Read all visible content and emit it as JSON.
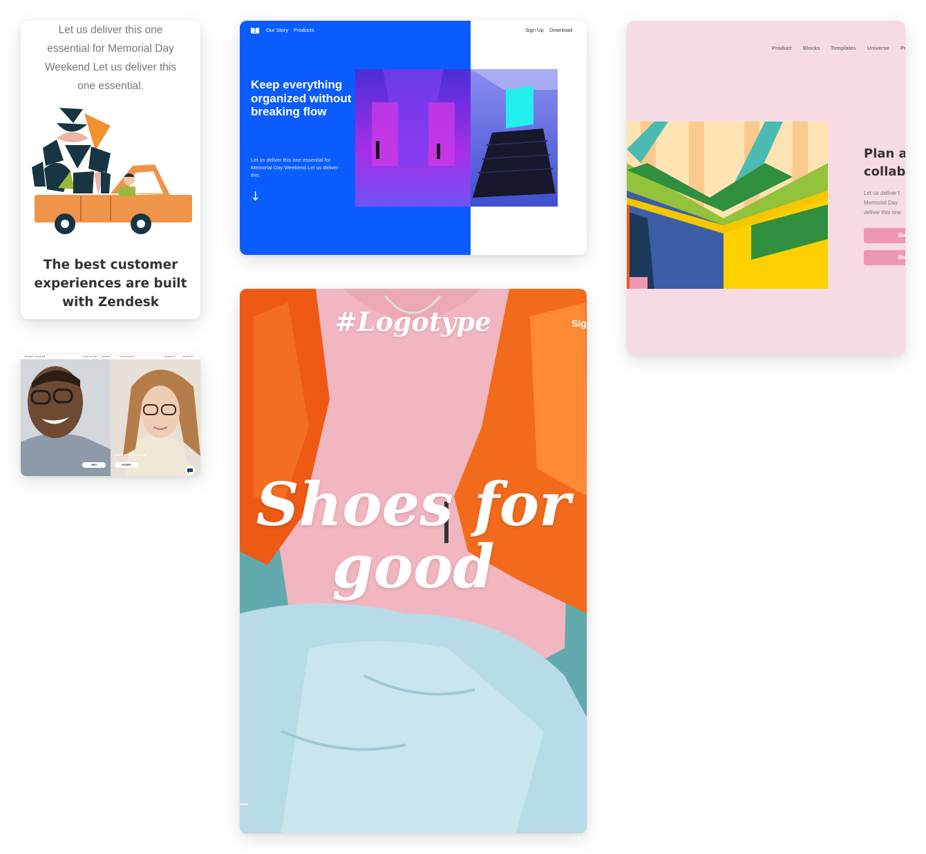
{
  "zendesk_card": {
    "intro": "Let us deliver this one essential for Memorial Day Weekend Let us deliver this one essential.",
    "headline": "The best customer experiences are built with Zendesk"
  },
  "warby_card": {
    "brand": "WARBY PARKER",
    "nav": [
      "OUR STORY",
      "EXAMS",
      "LOCATIONS"
    ],
    "search_label": "SEARCH",
    "signin_label": "SIGN IN",
    "shop_label": "SHOP ONLINE",
    "men_button": "MEN",
    "women_button": "WOMEN"
  },
  "blue_card": {
    "nav": [
      "Our Story",
      "Products"
    ],
    "right_nav": [
      "Sign Up",
      "Download"
    ],
    "headline": "Keep everything organized without breaking flow",
    "body": "Let us deliver this one essential for Memorial Day Weekend Let us deliver this.",
    "arrow": "↓",
    "colors": {
      "primary": "#0a5cff"
    }
  },
  "shoes_card": {
    "logotype": "#Logotype",
    "signin": "Sign",
    "hero": "Shoes for good"
  },
  "pink_card": {
    "nav": [
      "Product",
      "Blocks",
      "Templates",
      "Universe",
      "Pr"
    ],
    "headline_line1": "Plan ar",
    "headline_line2": "collabo",
    "body_line1": "Let us deliver t",
    "body_line2": "Memorial Day",
    "body_line3": "deliver this one",
    "button1": "Bu",
    "button2": "Bu",
    "colors": {
      "background": "#f7dbe4",
      "button": "#ee97b4"
    }
  }
}
